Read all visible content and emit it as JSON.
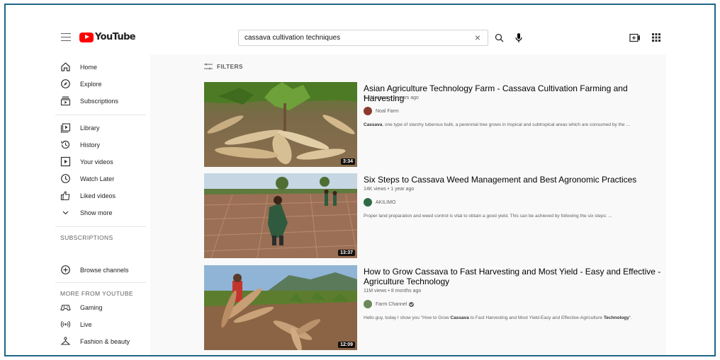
{
  "header": {
    "logo_text": "YouTube",
    "search_value": "cassava cultivation techniques",
    "clear_icon": "×"
  },
  "sidebar": {
    "items": [
      {
        "label": "Home",
        "icon": "home-icon"
      },
      {
        "label": "Explore",
        "icon": "compass-icon"
      },
      {
        "label": "Subscriptions",
        "icon": "subscriptions-icon"
      },
      {
        "label": "Library",
        "icon": "library-icon"
      },
      {
        "label": "History",
        "icon": "history-icon"
      },
      {
        "label": "Your videos",
        "icon": "play-square-icon"
      },
      {
        "label": "Watch Later",
        "icon": "clock-icon"
      },
      {
        "label": "Liked videos",
        "icon": "thumbs-up-icon"
      },
      {
        "label": "Show more",
        "icon": "chevron-down-icon"
      }
    ],
    "subscriptions_title": "SUBSCRIPTIONS",
    "browse_channels": "Browse channels",
    "more_title": "MORE FROM YOUTUBE",
    "more_items": [
      {
        "label": "Gaming",
        "icon": "gamepad-icon"
      },
      {
        "label": "Live",
        "icon": "live-icon"
      },
      {
        "label": "Fashion & beauty",
        "icon": "hanger-icon"
      }
    ]
  },
  "filters_label": "FILTERS",
  "videos": [
    {
      "title": "Asian Agriculture Technology Farm - Cassava Cultivation Farming and Harvesting",
      "meta": "9.1M views • 2 years ago",
      "channel": "Noal Farm",
      "desc_bold": "Cassava",
      "desc_rest": ", one type of starchy tuberous bulb, a perennial tree grows in tropical and subtropical areas which are consumed by the ...",
      "duration": "3:34",
      "verified": false
    },
    {
      "title": "Six Steps to Cassava Weed Management and Best Agronomic Practices",
      "meta": "14K views • 1 year ago",
      "channel": "AKILIMO",
      "desc_bold": "",
      "desc_rest": "Proper land preparation and weed control is vital to obtain a good yield. This can be achieved by following the six steps: ...",
      "duration": "13:37",
      "verified": false
    },
    {
      "title": "How to Grow Cassava to Fast Harvesting and Most Yield - Easy and Effective - Agriculture Technology",
      "meta": "11M views • 8 months ago",
      "channel": "Farm Channel",
      "desc_pre": "Hello guy, today I show you \"How to Grow ",
      "desc_bold": "Cassava",
      "desc_mid": " to Fast Harvesting and Most Yield-Easy and Effective-Agriculture ",
      "desc_bold2": "Technology",
      "desc_end": "\".",
      "duration": "12:09",
      "verified": true
    }
  ],
  "colors": {
    "brand_red": "#ff0000",
    "frame_border": "#1e6587",
    "content_bg": "#f9f9f9"
  }
}
